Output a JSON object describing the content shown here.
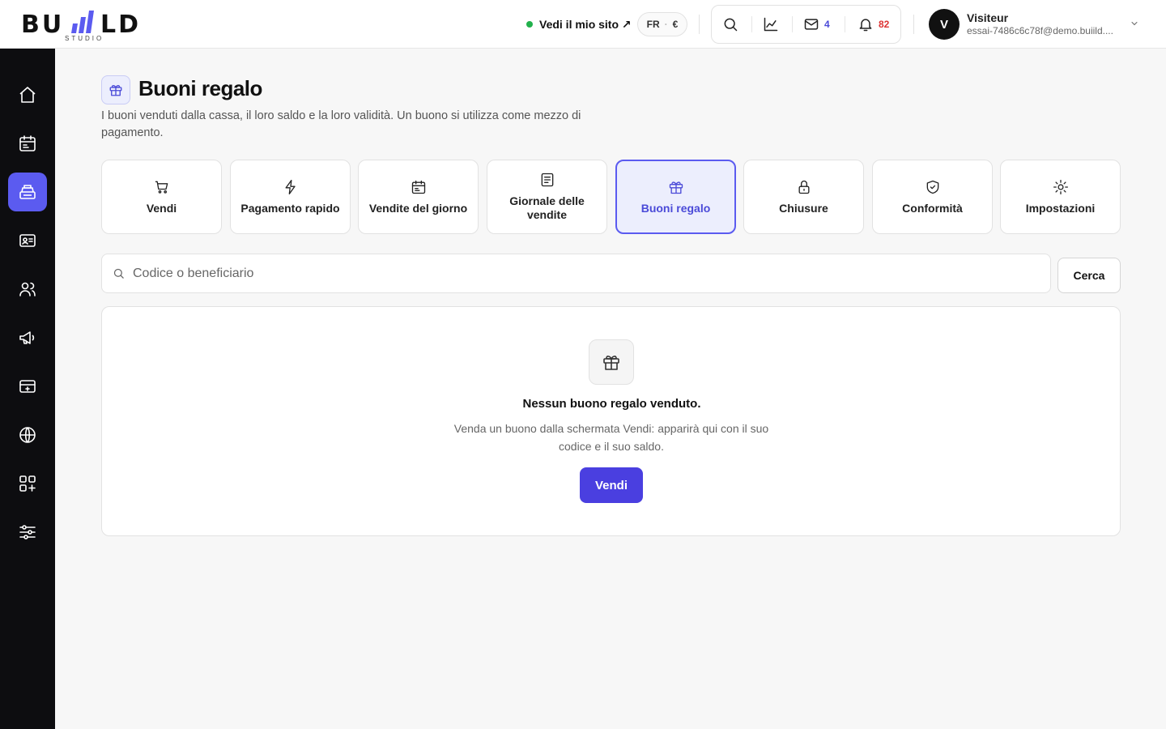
{
  "brand": {
    "logo_main": "BU",
    "logo_end": "LD",
    "logo_sub": "STUDIO",
    "accent": "#5b5bf0"
  },
  "header": {
    "site_link": "Vedi il mio sito ↗",
    "lang": "FR",
    "currency": "€",
    "mail_count": "4",
    "notif_count": "82",
    "user_initial": "V",
    "user_name": "Visiteur",
    "user_email": "essai-7486c6c78f@demo.buiild...."
  },
  "sidebar": {
    "items": [
      {
        "icon": "home-icon"
      },
      {
        "icon": "calendar-icon"
      },
      {
        "icon": "cash-register-icon",
        "active": true
      },
      {
        "icon": "contact-card-icon"
      },
      {
        "icon": "users-icon"
      },
      {
        "icon": "megaphone-icon"
      },
      {
        "icon": "payment-card-icon"
      },
      {
        "icon": "globe-icon"
      },
      {
        "icon": "apps-add-icon"
      },
      {
        "icon": "sliders-icon"
      }
    ]
  },
  "page": {
    "title": "Buoni regalo",
    "description": "I buoni venduti dalla cassa, il loro saldo e la loro validità. Un buono si utilizza come mezzo di pagamento."
  },
  "tabs": [
    {
      "label": "Vendi",
      "icon": "cart-icon"
    },
    {
      "label": "Pagamento rapido",
      "icon": "bolt-icon"
    },
    {
      "label": "Vendite del giorno",
      "icon": "calendar-icon"
    },
    {
      "label": "Giornale delle vendite",
      "icon": "document-icon"
    },
    {
      "label": "Buoni regalo",
      "icon": "gift-icon",
      "active": true
    },
    {
      "label": "Chiusure",
      "icon": "lock-icon"
    },
    {
      "label": "Conformità",
      "icon": "shield-check-icon"
    },
    {
      "label": "Impostazioni",
      "icon": "gear-icon"
    }
  ],
  "search": {
    "placeholder": "Codice o beneficiario",
    "button": "Cerca"
  },
  "empty": {
    "title": "Nessun buono regalo venduto.",
    "text": "Venda un buono dalla schermata Vendi: apparirà qui con il suo codice e il suo saldo.",
    "button": "Vendi"
  },
  "colors": {
    "mail_count": "#4a4ad8",
    "notif_count": "#d33",
    "status_dot": "#22b14c"
  }
}
